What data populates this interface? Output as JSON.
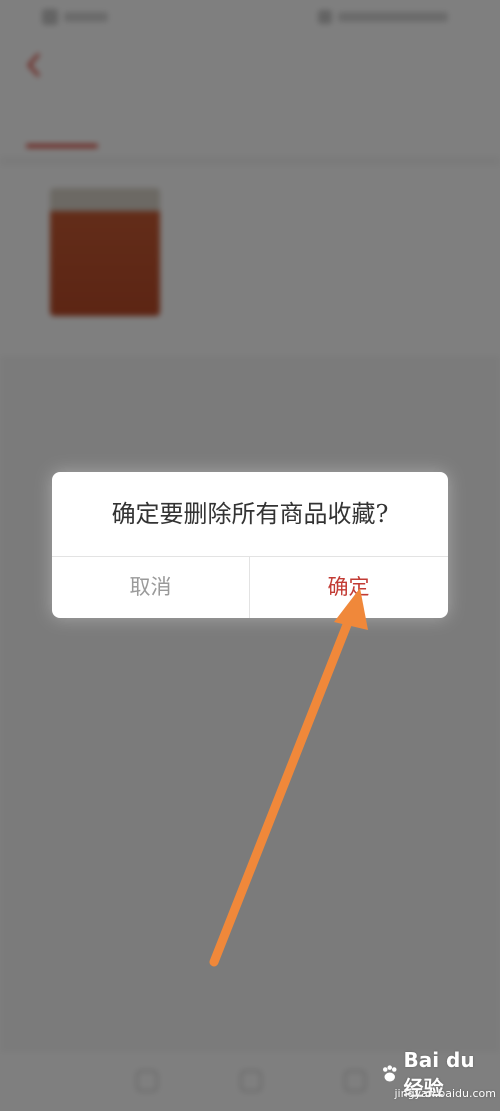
{
  "page": {
    "header": {
      "title": "",
      "action_label": ""
    },
    "tabs": [
      {
        "label": ""
      },
      {
        "label": ""
      },
      {
        "label": ""
      },
      {
        "label": ""
      }
    ],
    "product": {
      "name": "",
      "price": ""
    },
    "load_more": ""
  },
  "dialog": {
    "message": "确定要删除所有商品收藏?",
    "cancel_label": "取消",
    "confirm_label": "确定"
  },
  "watermark": {
    "logo_text": "Bai du 经验",
    "site": "jingyan.baidu.com"
  },
  "colors": {
    "overlay": "#000000",
    "confirm": "#c23b34",
    "cancel": "#9a9a9a",
    "arrow": "#f0883a",
    "active_tab": "#d9483b"
  },
  "icons": {
    "back": "chevron-left-icon",
    "arrow": "annotation-arrow"
  }
}
